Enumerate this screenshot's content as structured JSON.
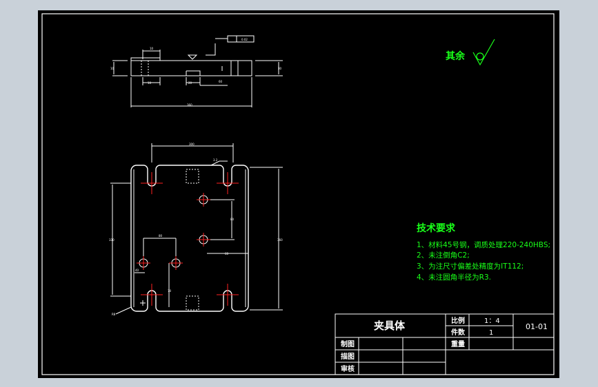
{
  "drawing": {
    "part_name": "夹具体",
    "scale_label": "比例",
    "scale_value": "1：4",
    "quantity_label": "件数",
    "quantity_value": "1",
    "drawing_no": "01-01",
    "weight_label": "重量",
    "rows": [
      "制图",
      "描图",
      "审核"
    ]
  },
  "surface": {
    "label": "其余",
    "section_note": "3.2"
  },
  "tech_req": {
    "title": "技术要求",
    "items": [
      "1、材料45号钢，调质处理220-240HBS;",
      "2、未注倒角C2;",
      "3、为注尺寸偏差处精度为IT112;",
      "4、未注圆角半径为R3."
    ]
  },
  "colors": {
    "background": "#000000",
    "border": "#ffffff",
    "outline": "#ffffff",
    "centerline": "#ff2020",
    "text": "#19ff19",
    "viewport_bg": "#c9d1d9"
  }
}
